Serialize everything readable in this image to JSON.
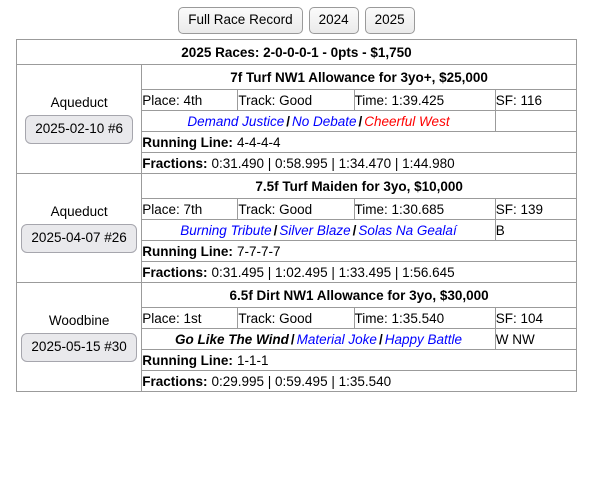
{
  "tabs": [
    {
      "label": "Full Race Record",
      "name": "tab-full-race-record"
    },
    {
      "label": "2024",
      "name": "tab-2024"
    },
    {
      "label": "2025",
      "name": "tab-2025"
    }
  ],
  "summary": "2025 Races: 2-0-0-0-1 - 0pts - $1,750",
  "labels": {
    "running_line": "Running Line:",
    "fractions": "Fractions:",
    "separator": "/"
  },
  "colors": {
    "link_blue": "#0000ff",
    "link_red": "#ff0000",
    "self_black": "#000000",
    "border": "#9b9b9b",
    "button_bg": "#e9e9ec"
  },
  "races": [
    {
      "venue": "Aqueduct",
      "date_label": "2025-02-10 #6",
      "title": "7f Turf NW1 Allowance for 3yo+, $25,000",
      "place": "Place: 4th",
      "track": "Track: Good",
      "time": "Time: 1:39.425",
      "sf": "SF: 116",
      "horses": [
        {
          "name": "Demand Justice",
          "color": "blue"
        },
        {
          "name": "No Debate",
          "color": "blue"
        },
        {
          "name": "Cheerful West",
          "color": "red"
        }
      ],
      "flag": "",
      "running_line": "4-4-4-4",
      "fractions": "0:31.490 | 0:58.995 | 1:34.470 | 1:44.980"
    },
    {
      "venue": "Aqueduct",
      "date_label": "2025-04-07 #26",
      "title": "7.5f Turf Maiden for 3yo, $10,000",
      "place": "Place: 7th",
      "track": "Track: Good",
      "time": "Time: 1:30.685",
      "sf": "SF: 139",
      "horses": [
        {
          "name": "Burning Tribute",
          "color": "blue"
        },
        {
          "name": "Silver Blaze",
          "color": "blue"
        },
        {
          "name": "Solas Na Gealaí",
          "color": "blue"
        }
      ],
      "flag": "B",
      "running_line": "7-7-7-7",
      "fractions": "0:31.495 | 1:02.495 | 1:33.495 | 1:56.645"
    },
    {
      "venue": "Woodbine",
      "date_label": "2025-05-15 #30",
      "title": "6.5f Dirt NW1 Allowance for 3yo, $30,000",
      "place": "Place: 1st",
      "track": "Track: Good",
      "time": "Time: 1:35.540",
      "sf": "SF: 104",
      "horses": [
        {
          "name": "Go Like The Wind",
          "color": "self"
        },
        {
          "name": "Material Joke",
          "color": "blue"
        },
        {
          "name": "Happy Battle",
          "color": "blue"
        }
      ],
      "flag": "W NW",
      "running_line": "1-1-1",
      "fractions": "0:29.995 | 0:59.495 | 1:35.540"
    }
  ]
}
